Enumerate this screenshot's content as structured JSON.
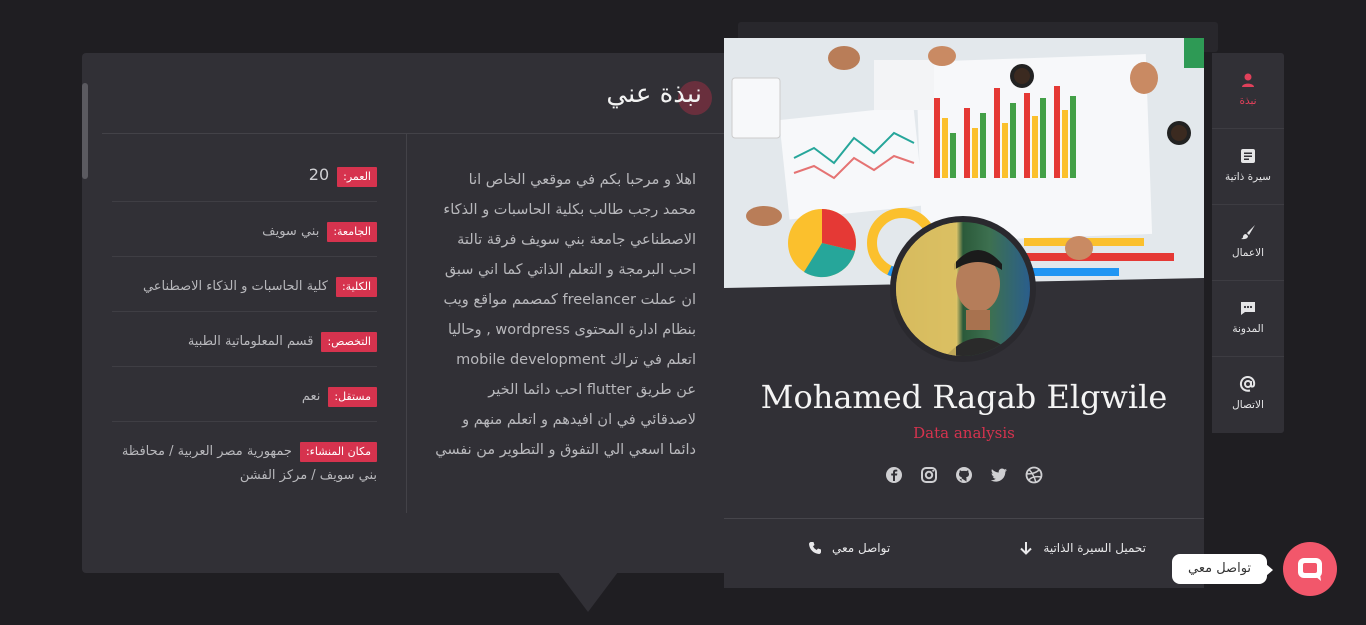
{
  "about": {
    "title": "نبذة عني",
    "bio": "اهلا و مرحبا بكم في موقعي الخاص انا محمد رجب طالب بكلية الحاسبات و الذكاء الاصطناعي جامعة بني سويف فرقة تالتة احب البرمجة و التعلم الذاتي كما اني سبق ان عملت freelancer كمصمم مواقع ويب بنظام ادارة المحتوى wordpress , وحاليا اتعلم في تراك mobile development عن طريق flutter احب دائما الخير لاصدقائي في ان افيدهم و اتعلم منهم و دائما اسعي الي التفوق و التطوير من نفسي",
    "info": [
      {
        "label": "العمر:",
        "value": "20"
      },
      {
        "label": "الجامعة:",
        "value": "بني سويف"
      },
      {
        "label": "الكلية:",
        "value": "كلية الحاسبات و الذكاء الاصطناعي"
      },
      {
        "label": "التخصص:",
        "value": "قسم المعلوماتية الطبية"
      },
      {
        "label": "مستقل:",
        "value": "نعم"
      },
      {
        "label": "مكان المنشاء:",
        "value": "جمهورية مصر العربية / محافظة بني سويف / مركز الفشن"
      }
    ]
  },
  "profile": {
    "name": "Mohamed Ragab Elgwile",
    "role": "Data analysis",
    "socials": [
      "dribbble-icon",
      "twitter-icon",
      "github-icon",
      "instagram-icon",
      "facebook-icon"
    ],
    "download_cv": "تحميل السيرة الذاتية",
    "contact_me": "تواصل معي"
  },
  "nav": [
    {
      "label": "نبذة",
      "icon": "user-icon",
      "active": true
    },
    {
      "label": "سيرة ذاتية",
      "icon": "resume-icon",
      "active": false
    },
    {
      "label": "الاعمال",
      "icon": "brush-icon",
      "active": false
    },
    {
      "label": "المدونة",
      "icon": "chat-bubble-icon",
      "active": false
    },
    {
      "label": "الاتصال",
      "icon": "at-icon",
      "active": false
    }
  ],
  "chat_widget": {
    "label": "تواصل معي"
  },
  "colors": {
    "accent": "#d6334e",
    "panel": "#313036",
    "background": "#1f1e22",
    "chat": "#f2576b"
  }
}
